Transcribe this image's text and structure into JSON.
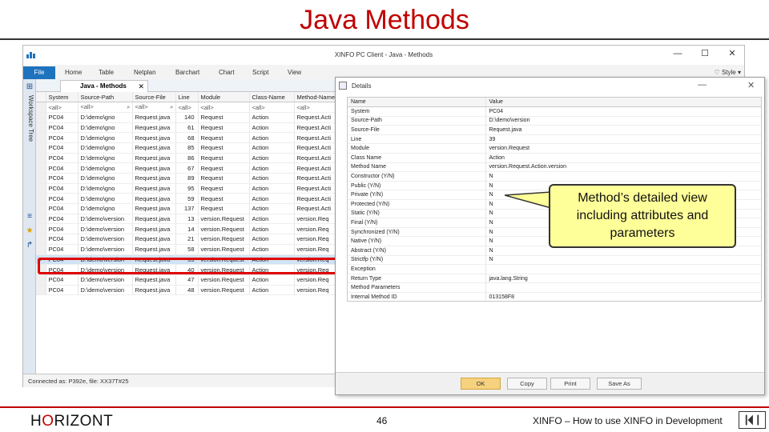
{
  "slide": {
    "title": "Java Methods",
    "brand_prefix": "H",
    "brand_o": "O",
    "brand_suffix": "RIZONT",
    "page_number": "46",
    "footer_text": "XINFO – How to use XINFO in Development",
    "callout": "Method’s detailed view including attributes and parameters"
  },
  "app": {
    "title": "XINFO PC Client - Java - Methods",
    "window_controls": [
      "—",
      "☐",
      "✕"
    ],
    "menu": {
      "file": "File",
      "items": [
        "Home",
        "Table",
        "Netplan",
        "Barchart",
        "Chart",
        "Script",
        "View"
      ],
      "style": "Style"
    },
    "workspace_label": "Workspace Tree",
    "tab": {
      "label": "Java - Methods",
      "close": "✕"
    },
    "columns": [
      "System",
      "Source-Path",
      "Source-File",
      "Line",
      "Module",
      "Class-Name",
      "Method-Name"
    ],
    "filter_row": [
      "<all>",
      "<all>",
      "<all>",
      "<all>",
      "<all>",
      "<all>",
      "<all>"
    ],
    "rows": [
      [
        "PC04",
        "D:\\demo\\gno",
        "Request.java",
        "140",
        "Request",
        "Action",
        "Request.Acti"
      ],
      [
        "PC04",
        "D:\\demo\\gno",
        "Request.java",
        "61",
        "Request",
        "Action",
        "Request.Acti"
      ],
      [
        "PC04",
        "D:\\demo\\gno",
        "Request.java",
        "68",
        "Request",
        "Action",
        "Request.Acti"
      ],
      [
        "PC04",
        "D:\\demo\\gno",
        "Request.java",
        "85",
        "Request",
        "Action",
        "Request.Acti"
      ],
      [
        "PC04",
        "D:\\demo\\gno",
        "Request.java",
        "86",
        "Request",
        "Action",
        "Request.Acti"
      ],
      [
        "PC04",
        "D:\\demo\\gno",
        "Request.java",
        "67",
        "Request",
        "Action",
        "Request.Acti"
      ],
      [
        "PC04",
        "D:\\demo\\gno",
        "Request.java",
        "89",
        "Request",
        "Action",
        "Request.Acti"
      ],
      [
        "PC04",
        "D:\\demo\\gno",
        "Request.java",
        "95",
        "Request",
        "Action",
        "Request.Acti"
      ],
      [
        "PC04",
        "D:\\demo\\gno",
        "Request.java",
        "59",
        "Request",
        "Action",
        "Request.Acti"
      ],
      [
        "PC04",
        "D:\\demo\\gno",
        "Request.java",
        "137",
        "Request",
        "Action",
        "Request.Acti"
      ],
      [
        "PC04",
        "D:\\demo\\version",
        "Request.java",
        "13",
        "version.Request",
        "Action",
        "version.Req"
      ],
      [
        "PC04",
        "D:\\demo\\version",
        "Request.java",
        "14",
        "version.Request",
        "Action",
        "version.Req"
      ],
      [
        "PC04",
        "D:\\demo\\version",
        "Request.java",
        "21",
        "version.Request",
        "Action",
        "version.Req"
      ],
      [
        "PC04",
        "D:\\demo\\version",
        "Request.java",
        "58",
        "version.Request",
        "Action",
        "version.Req"
      ],
      [
        "PC04",
        "D:\\demo\\version",
        "Request.java",
        "39",
        "version.Request",
        "Action",
        "version.Req"
      ],
      [
        "PC04",
        "D:\\demo\\version",
        "Request.java",
        "40",
        "version.Request",
        "Action",
        "version.Req"
      ],
      [
        "PC04",
        "D:\\demo\\version",
        "Request.java",
        "47",
        "version.Request",
        "Action",
        "version.Req"
      ],
      [
        "PC04",
        "D:\\demo\\version",
        "Request.java",
        "48",
        "version.Request",
        "Action",
        "version.Req"
      ]
    ],
    "selected_row": 14,
    "status": "Connected as: P392e, file: XX37T#25"
  },
  "details": {
    "title": "Details",
    "columns": [
      "Name",
      "Value"
    ],
    "rows": [
      [
        "System",
        "PC04"
      ],
      [
        "Source-Path",
        "D:\\demo\\version"
      ],
      [
        "Source-File",
        "Request.java"
      ],
      [
        "Line",
        "39"
      ],
      [
        "Module",
        "version.Request"
      ],
      [
        "Class Name",
        "Action"
      ],
      [
        "Method Name",
        "version.Request.Action.version"
      ],
      [
        "Constructor (Y/N)",
        "N"
      ],
      [
        "Public (Y/N)",
        "N"
      ],
      [
        "Private (Y/N)",
        "N"
      ],
      [
        "Protected (Y/N)",
        "N"
      ],
      [
        "Static (Y/N)",
        "N"
      ],
      [
        "Final (Y/N)",
        "N"
      ],
      [
        "Synchronized (Y/N)",
        "N"
      ],
      [
        "Native (Y/N)",
        "N"
      ],
      [
        "Abstract (Y/N)",
        "N"
      ],
      [
        "Strictfp (Y/N)",
        "N"
      ],
      [
        "Exception",
        ""
      ],
      [
        "Return Type",
        "java.lang.String"
      ],
      [
        "Method Parameters",
        ""
      ],
      [
        "Internal Method ID",
        "013158F8"
      ]
    ],
    "buttons": [
      "OK",
      "Copy",
      "Print",
      "Save As"
    ],
    "controls": [
      "—",
      "✕"
    ]
  }
}
